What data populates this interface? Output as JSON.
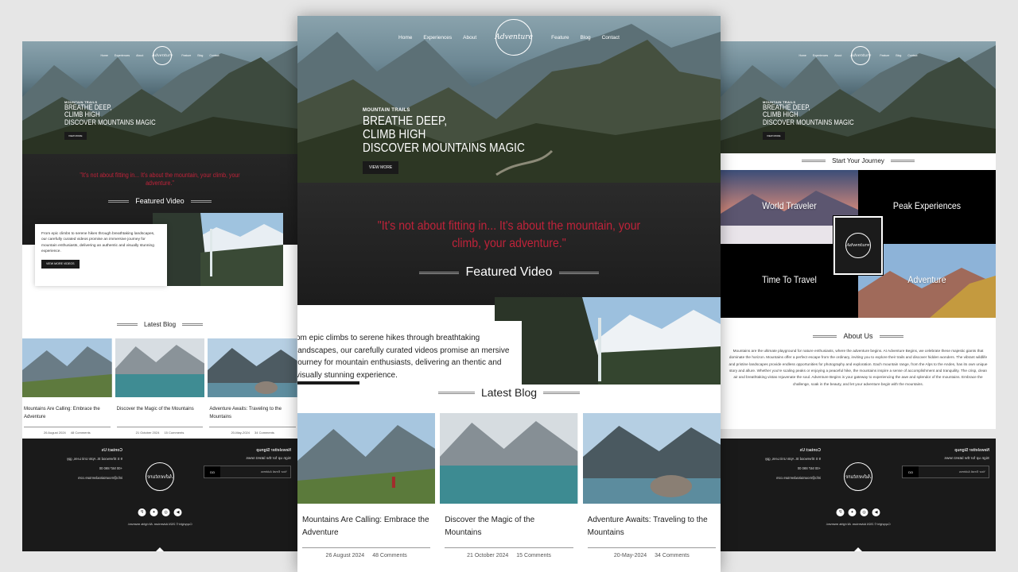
{
  "nav": {
    "items": [
      "Home",
      "Experiences",
      "About"
    ],
    "items_right": [
      "Feature",
      "Blog",
      "Contact"
    ],
    "logo_text": "Adventure"
  },
  "hero": {
    "kicker": "MOUNTAIN TRAILS",
    "line1": "BREATHE DEEP,",
    "line2": "CLIMB HIGH",
    "line3": "DISCOVER MOUNTAINS MAGIC",
    "button": "VIEW MORE"
  },
  "quote": {
    "text": "\"It's not about fitting in... It's about the mountain, your climb, your adventure.\""
  },
  "featured_video": {
    "title": "Featured Video",
    "text_center": "om epic climbs to serene hikes through breathtaking landscapes, our carefully curated videos promise an mersive journey for mountain enthusiasts, delivering an thentic and visually stunning experience.",
    "text_left": "From epic climbs to serene hikes through breathtaking landscapes, our carefully curated videos promise an immersive journey for mountain enthusiasts, delivering an authentic and visually stunning experience.",
    "button": "VIEW MORE VIDEOS"
  },
  "latest_blog": {
    "title": "Latest Blog",
    "posts": [
      {
        "title": "Mountains Are Calling: Embrace the Adventure",
        "date": "26 August 2024",
        "comments": "48 Comments"
      },
      {
        "title": "Discover the Magic of the Mountains",
        "date": "21 October 2024",
        "comments": "15 Comments"
      },
      {
        "title": "Adventure Awaits: Traveling to the Mountains",
        "date": "20-May-2024",
        "comments": "34 Comments"
      }
    ]
  },
  "journey": {
    "title": "Start Your Journey",
    "tiles": [
      "World Traveler",
      "Peak Experiences",
      "Time To Travel",
      "Adventure"
    ]
  },
  "about": {
    "title": "About Us",
    "text": "Mountains are the ultimate playground for nature enthusiasts, where the adventure begins. At Adventure Begins, we celebrate these majestic giants that dominate the horizon. Mountains offer a perfect escape from the ordinary, inviting you to explore their trails and discover hidden wonders. The vibrant wildlife and pristine landscapes provide endless opportunities for photography and exploration. Each mountain range, from the Alps to the Andes, has its own unique story and allure. Whether you're scaling peaks or enjoying a peaceful hike, the mountains inspire a sense of accomplishment and tranquility. The crisp, clean air and breathtaking vistas rejuvenate the soul. Adventure Begins is your gateway to experiencing the awe and splendor of the mountains. Embrace the challenge, soak in the beauty, and let your adventure begin with the mountains."
  },
  "footer": {
    "newsletter_title": "Newsletter Signup",
    "newsletter_text": "Sign up for the latest news",
    "email_placeholder": "Your Email Address",
    "go": "GO",
    "contact_title": "Contact Us",
    "address": "9 S Sherwood St. Aptn Unit Lens, gpy",
    "phone": "+00 567 890 00",
    "email": "info@mountainadventure.com",
    "copyright": "Copyright © 2024 Adventure. All rights reserved.",
    "social_icons": [
      "youtube-icon",
      "instagram-icon",
      "twitter-icon",
      "pinterest-icon"
    ]
  },
  "colors": {
    "accent_red": "#c0233a",
    "dark": "#1a1a1a"
  }
}
